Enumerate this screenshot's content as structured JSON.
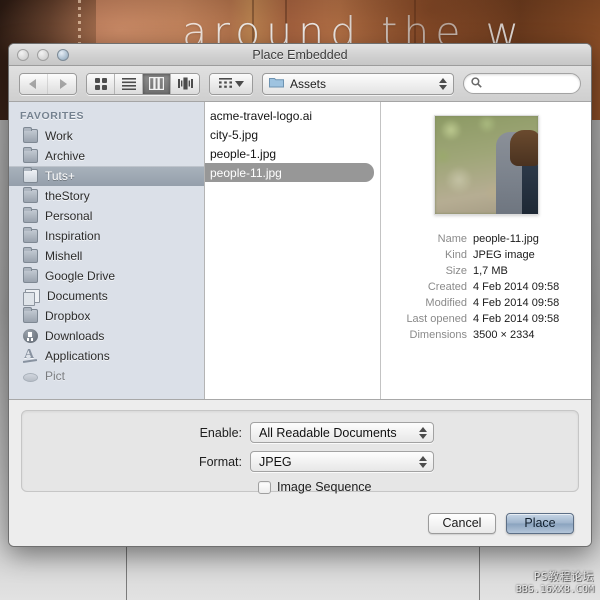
{
  "background": {
    "headline_text": "around the w",
    "watermark_line1": "PS教程论坛",
    "watermark_line2": "BBS.16XX8.COM"
  },
  "dialog": {
    "title": "Place Embedded",
    "window_controls": [
      "close",
      "minimize",
      "zoom"
    ]
  },
  "toolbar": {
    "nav": {
      "back_icon": "chevron-left-icon",
      "forward_icon": "chevron-right-icon"
    },
    "view_modes": [
      {
        "name": "icon-view",
        "icon": "grid-icon",
        "active": false
      },
      {
        "name": "list-view",
        "icon": "list-icon",
        "active": false
      },
      {
        "name": "column-view",
        "icon": "columns-icon",
        "active": true
      },
      {
        "name": "coverflow-view",
        "icon": "coverflow-icon",
        "active": false
      }
    ],
    "action_menu": {
      "icon": "action-grid-icon",
      "chevron": "chevron-down-icon"
    },
    "path_popup": {
      "icon": "folder-icon",
      "label": "Assets"
    },
    "search": {
      "icon": "search-icon",
      "value": "",
      "placeholder": ""
    }
  },
  "sidebar": {
    "header": "FAVORITES",
    "items": [
      {
        "label": "Work",
        "icon": "folder-icon",
        "selected": false
      },
      {
        "label": "Archive",
        "icon": "folder-icon",
        "selected": false
      },
      {
        "label": "Tuts+",
        "icon": "folder-icon",
        "selected": true
      },
      {
        "label": "theStory",
        "icon": "folder-icon",
        "selected": false
      },
      {
        "label": "Personal",
        "icon": "folder-icon",
        "selected": false
      },
      {
        "label": "Inspiration",
        "icon": "folder-icon",
        "selected": false
      },
      {
        "label": "Mishell",
        "icon": "folder-icon",
        "selected": false
      },
      {
        "label": "Google Drive",
        "icon": "folder-icon",
        "selected": false
      },
      {
        "label": "Documents",
        "icon": "documents-icon",
        "selected": false
      },
      {
        "label": "Dropbox",
        "icon": "folder-icon",
        "selected": false
      },
      {
        "label": "Downloads",
        "icon": "download-icon",
        "selected": false
      },
      {
        "label": "Applications",
        "icon": "applications-icon",
        "selected": false
      },
      {
        "label": "Pict",
        "icon": "disc-icon",
        "selected": false
      }
    ]
  },
  "filelist": {
    "files": [
      {
        "name": "acme-travel-logo.ai",
        "selected": false
      },
      {
        "name": "city-5.jpg",
        "selected": false
      },
      {
        "name": "people-1.jpg",
        "selected": false
      },
      {
        "name": "people-11.jpg",
        "selected": true
      }
    ]
  },
  "preview": {
    "thumbnail_alt": "people-11.jpg preview",
    "metadata": [
      {
        "label": "Name",
        "value": "people-11.jpg"
      },
      {
        "label": "Kind",
        "value": "JPEG image"
      },
      {
        "label": "Size",
        "value": "1,7 MB"
      },
      {
        "label": "Created",
        "value": "4 Feb 2014 09:58"
      },
      {
        "label": "Modified",
        "value": "4 Feb 2014 09:58"
      },
      {
        "label": "Last opened",
        "value": "4 Feb 2014 09:58"
      },
      {
        "label": "Dimensions",
        "value": "3500 × 2334"
      }
    ]
  },
  "options": {
    "enable_label": "Enable:",
    "enable_value": "All Readable Documents",
    "format_label": "Format:",
    "format_value": "JPEG",
    "image_sequence_label": "Image Sequence",
    "image_sequence_checked": false
  },
  "footer": {
    "cancel_label": "Cancel",
    "place_label": "Place"
  },
  "colors": {
    "sidebar_bg": "#dbe0e8",
    "selection_blue_gray": "#9aa3ae",
    "file_selection": "#979797",
    "default_button": "#9fb4cc"
  }
}
